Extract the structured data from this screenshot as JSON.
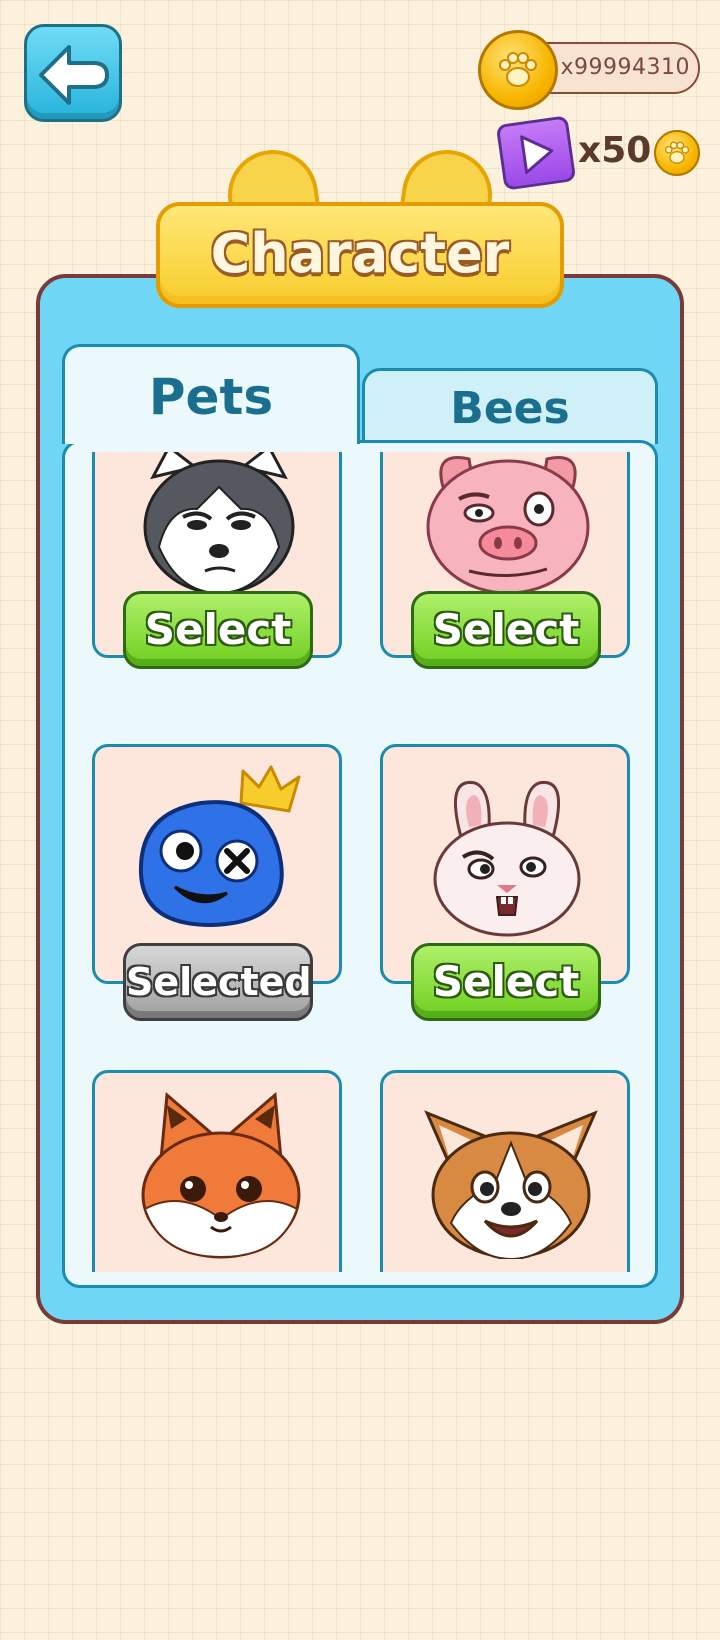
{
  "header": {
    "title": "Character",
    "coins": "x99994310",
    "reward_label": "x50"
  },
  "tabs": [
    {
      "label": "Pets",
      "active": true
    },
    {
      "label": "Bees",
      "active": false
    }
  ],
  "characters": [
    {
      "name": "husky",
      "button": "Select",
      "state": "select"
    },
    {
      "name": "pig",
      "button": "Select",
      "state": "select"
    },
    {
      "name": "blue-blob",
      "button": "Selected",
      "state": "selected"
    },
    {
      "name": "bunny",
      "button": "Select",
      "state": "select"
    },
    {
      "name": "fox",
      "button": "",
      "state": "select"
    },
    {
      "name": "corgi",
      "button": "",
      "state": "select"
    }
  ],
  "colors": {
    "panel": "#6fd6f5",
    "banner": "#f7cd2d",
    "select_button": "#6fcf1f",
    "selected_button": "#9f9f9f"
  }
}
